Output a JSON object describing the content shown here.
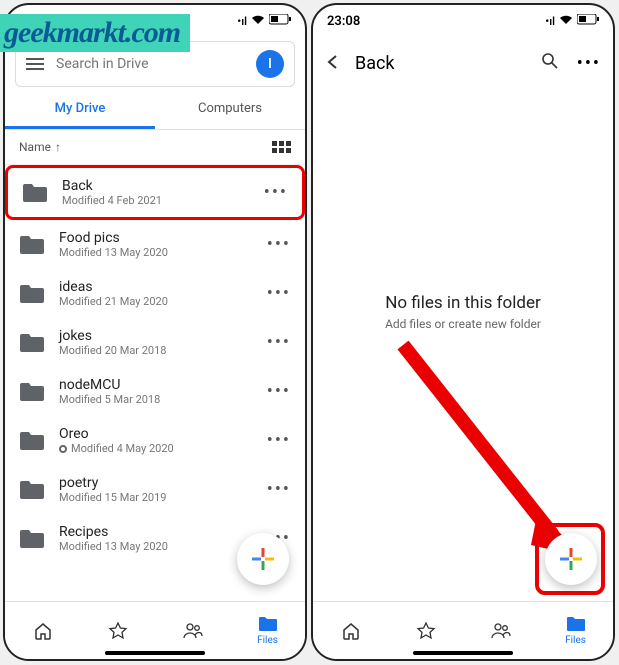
{
  "watermark": "geekmarkt.com",
  "status": {
    "time": "23:08"
  },
  "left": {
    "search_placeholder": "Search in Drive",
    "avatar_initial": "I",
    "tabs": {
      "mydrive": "My Drive",
      "computers": "Computers"
    },
    "sort_label": "Name",
    "files": [
      {
        "name": "Back",
        "meta": "Modified 4 Feb 2021",
        "highlighted": true
      },
      {
        "name": "Food pics",
        "meta": "Modified 13 May 2020"
      },
      {
        "name": "ideas",
        "meta": "Modified 21 May 2020"
      },
      {
        "name": "jokes",
        "meta": "Modified 20 Mar 2018"
      },
      {
        "name": "nodeMCU",
        "meta": "Modified 5 Mar 2018"
      },
      {
        "name": "Oreo",
        "meta": "Modified 4 May 2020",
        "offline": true
      },
      {
        "name": "poetry",
        "meta": "Modified 15 Mar 2019"
      },
      {
        "name": "Recipes",
        "meta": "Modified 13 May 2020"
      }
    ]
  },
  "right": {
    "title": "Back",
    "empty_title": "No files in this folder",
    "empty_sub": "Add files or create new folder"
  },
  "nav": {
    "files_label": "Files"
  }
}
